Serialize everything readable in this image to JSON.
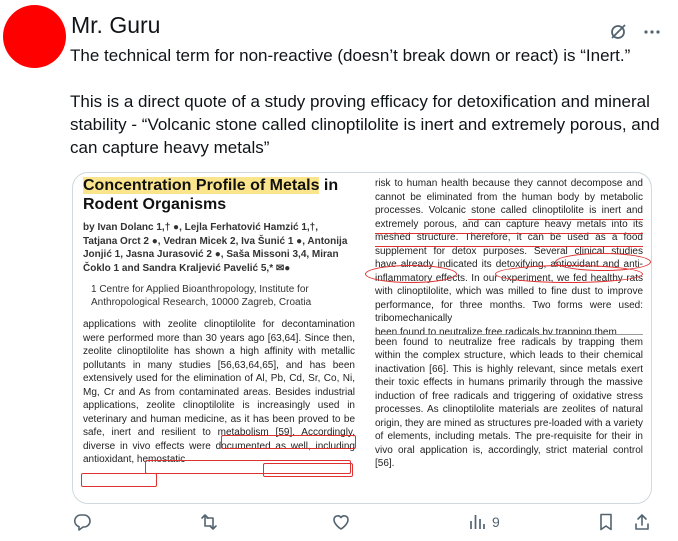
{
  "author": {
    "name": "Mr. Guru"
  },
  "post": {
    "line1": "The technical term for non-reactive (doesn’t break down or react) is “Inert.”",
    "line2": "This is a direct quote of a study proving efficacy for detoxification and mineral stability - “Volcanic stone called clinoptilolite is inert and extremely porous, and can capture heavy metals”"
  },
  "paper": {
    "title_part1": "Concentration Profile of Metals",
    "title_part2": " in Rodent Organisms",
    "authors": "by Ivan Dolanc 1,† ●, Lejla Ferhatović Hamzić 1,†, Tatjana Orct 2 ●, Vedran Micek 2, Iva Šunić 1 ●, Antonija Jonjić 1, Jasna Jurasović 2 ●, Saša Missoni 3,4, Miran Čoklo 1 and Sandra Kraljević Pavelić 5,* ✉●",
    "affiliation": "1 Centre for Applied Bioanthropology, Institute for Anthropological Research, 10000 Zagreb, Croatia",
    "left_body": "applications with zeolite clinoptilolite for decontamination were performed more than 30 years ago [63,64]. Since then, zeolite clinoptilolite has shown a high affinity with metallic pollutants in many studies [56,63,64,65], and has been extensively used for the elimination of Al, Pb, Cd, Sr, Co, Ni, Mg, Cr and As from contaminated areas. Besides industrial applications, zeolite clinoptilolite is increasingly used in veterinary and human medicine, as it has been proved to be safe, inert and resilient to metabolism [59]. Accordingly, diverse in vivo effects were documented as well, including antioxidant, hemostatic",
    "right_top": "risk to human health because they cannot decompose and cannot be eliminated from the human body by metabolic processes. Volcanic stone called clinoptilolite is inert and extremely porous, and can capture heavy metals into its meshed structure. Therefore, it can be used as a food supplement for detox purposes. Several clinical studies have already indicated its detoxifying, antioxidant and anti-inflammatory effects. In our experiment, we fed healthy rats with clinoptilolite, which was milled to fine dust to improve performance, for three months. Two forms were used: tribomechanically",
    "right_cut": "been found to neutralize free radicals by trapping them",
    "right_bottom": "been found to neutralize free radicals by trapping them within the complex structure, which leads to their chemical inactivation [66]. This is highly relevant, since metals exert their toxic effects in humans primarily through the massive induction of free radicals and triggering of oxidative stress processes. As clinoptilolite materials are zeolites of natural origin, they are mined as structures pre-loaded with a variety of elements, including metals. The pre-requisite for their in vivo oral application is, accordingly, strict material control [56]."
  },
  "actions": {
    "views": "9"
  },
  "icons": [
    "grok-icon",
    "more-icon",
    "reply-icon",
    "repost-icon",
    "like-icon",
    "views-icon",
    "bookmark-icon",
    "share-icon"
  ],
  "colors": {
    "avatar": "#ff0000",
    "highlight": "#fbe58c",
    "annotation": "#e03131",
    "icon": "#536471"
  }
}
